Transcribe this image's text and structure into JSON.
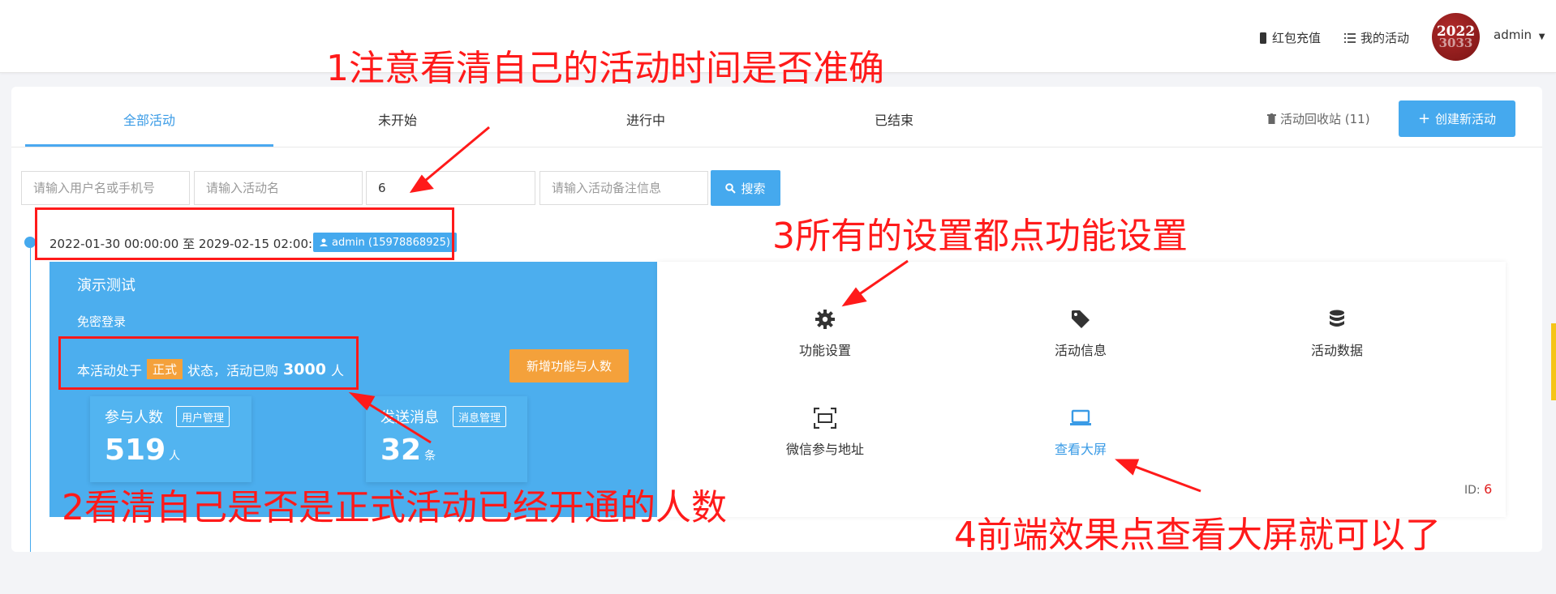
{
  "header": {
    "recharge_label": "红包充值",
    "my_activity_label": "我的活动",
    "avatar_text": [
      "2022",
      "3033"
    ],
    "username": "admin"
  },
  "tabs": [
    {
      "label": "全部活动",
      "active": true
    },
    {
      "label": "未开始"
    },
    {
      "label": "进行中"
    },
    {
      "label": "已结束"
    }
  ],
  "toolbar": {
    "recycle_label": "活动回收站 (11)",
    "create_label": "创建新活动"
  },
  "filters": {
    "user_placeholder": "请输入用户名或手机号",
    "activity_placeholder": "请输入活动名",
    "id_value": "6",
    "remark_placeholder": "请输入活动备注信息",
    "search_label": "搜索"
  },
  "activity": {
    "date_range": "2022-01-30 00:00:00 至 2029-02-15 02:00:00",
    "owner_badge": "admin (15978868925)",
    "title": "演示测试",
    "subtitle": "免密登录",
    "status_prefix": "本活动处于",
    "status_badge": "正式",
    "status_middle": "状态，活动已购",
    "purchased_count": "3000",
    "status_suffix": "人",
    "add_feature_label": "新增功能与人数",
    "stats": [
      {
        "label": "参与人数",
        "button": "用户管理",
        "value": "519",
        "unit": "人"
      },
      {
        "label": "发送消息",
        "button": "消息管理",
        "value": "32",
        "unit": "条"
      }
    ],
    "functions": [
      {
        "label": "功能设置",
        "icon": "gear-icon"
      },
      {
        "label": "活动信息",
        "icon": "tag-icon"
      },
      {
        "label": "活动数据",
        "icon": "database-icon"
      },
      {
        "label": "微信参与地址",
        "icon": "scan-icon"
      },
      {
        "label": "查看大屏",
        "icon": "laptop-icon"
      }
    ],
    "id_label": "ID:",
    "id_value": "6"
  },
  "annotations": {
    "note1": "1注意看清自己的活动时间是否准确",
    "note2": "2看清自己是否是正式活动已经开通的人数",
    "note3": "3所有的设置都点功能设置",
    "note4": "4前端效果点查看大屏就可以了"
  },
  "colors": {
    "primary": "#45a9ee",
    "panel_blue": "#4caeee",
    "orange": "#f4a13b",
    "annotation_red": "#ff1a1a"
  }
}
